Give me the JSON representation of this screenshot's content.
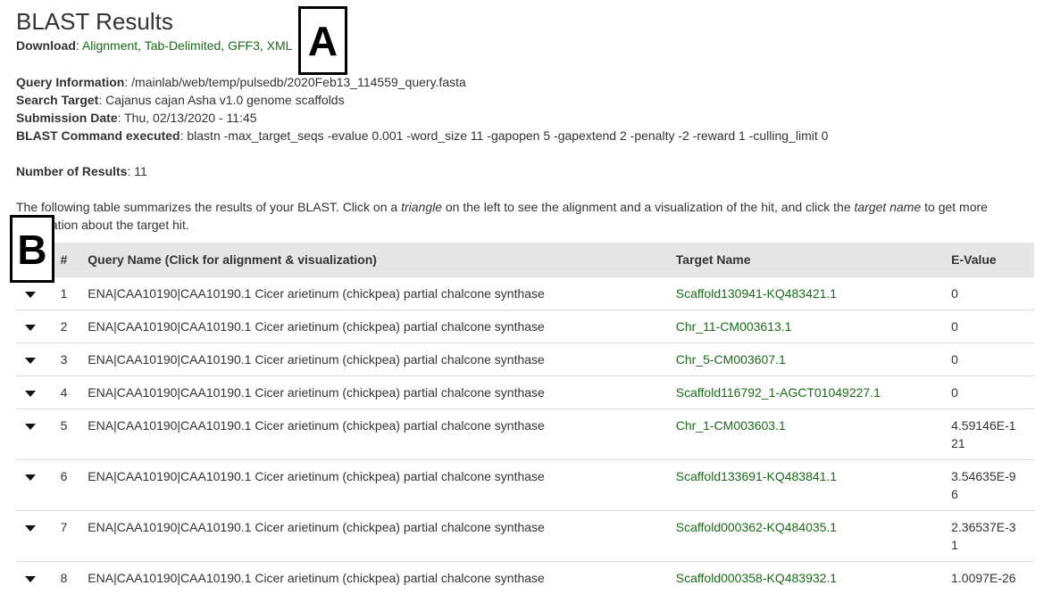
{
  "title": "BLAST Results",
  "download": {
    "label": "Download",
    "links": [
      "Alignment",
      "Tab-Delimited",
      "GFF3",
      "XML"
    ]
  },
  "query_info": {
    "label": "Query Information",
    "value": "/mainlab/web/temp/pulsedb/2020Feb13_114559_query.fasta"
  },
  "search_target": {
    "label": "Search Target",
    "value": "Cajanus cajan Asha v1.0 genome scaffolds"
  },
  "submission_date": {
    "label": "Submission Date",
    "value": "Thu, 02/13/2020 - 11:45"
  },
  "blast_command": {
    "label": "BLAST Command executed",
    "value": "blastn -max_target_seqs -evalue 0.001 -word_size 11 -gapopen 5 -gapextend 2 -penalty -2 -reward 1 -culling_limit 0"
  },
  "num_results": {
    "label": "Number of Results",
    "value": "11"
  },
  "description": {
    "part1": "The following table summarizes the results of your BLAST. Click on a ",
    "em1": "triangle",
    "part2": " on the left to see the alignment and a visualization of the hit, and click the ",
    "em2": "target name",
    "part3": " to get more information about the target hit."
  },
  "table": {
    "headers": {
      "num": "#",
      "query": "Query Name (Click for alignment & visualization)",
      "target": "Target Name",
      "evalue": "E-Value"
    },
    "rows": [
      {
        "num": "1",
        "query": "ENA|CAA10190|CAA10190.1 Cicer arietinum (chickpea) partial chalcone synthase",
        "target": "Scaffold130941-KQ483421.1",
        "evalue": "0"
      },
      {
        "num": "2",
        "query": "ENA|CAA10190|CAA10190.1 Cicer arietinum (chickpea) partial chalcone synthase",
        "target": "Chr_11-CM003613.1",
        "evalue": "0"
      },
      {
        "num": "3",
        "query": "ENA|CAA10190|CAA10190.1 Cicer arietinum (chickpea) partial chalcone synthase",
        "target": "Chr_5-CM003607.1",
        "evalue": "0"
      },
      {
        "num": "4",
        "query": "ENA|CAA10190|CAA10190.1 Cicer arietinum (chickpea) partial chalcone synthase",
        "target": "Scaffold116792_1-AGCT01049227.1",
        "evalue": "0"
      },
      {
        "num": "5",
        "query": "ENA|CAA10190|CAA10190.1 Cicer arietinum (chickpea) partial chalcone synthase",
        "target": "Chr_1-CM003603.1",
        "evalue": "4.59146E-121"
      },
      {
        "num": "6",
        "query": "ENA|CAA10190|CAA10190.1 Cicer arietinum (chickpea) partial chalcone synthase",
        "target": "Scaffold133691-KQ483841.1",
        "evalue": "3.54635E-96"
      },
      {
        "num": "7",
        "query": "ENA|CAA10190|CAA10190.1 Cicer arietinum (chickpea) partial chalcone synthase",
        "target": "Scaffold000362-KQ484035.1",
        "evalue": "2.36537E-31"
      },
      {
        "num": "8",
        "query": "ENA|CAA10190|CAA10190.1 Cicer arietinum (chickpea) partial chalcone synthase",
        "target": "Scaffold000358-KQ483932.1",
        "evalue": "1.0097E-26"
      }
    ]
  },
  "annotations": {
    "a": "A",
    "b": "B"
  },
  "colors": {
    "link": "#1b6b1b",
    "header_bg": "#e6e6e6",
    "text": "#333333"
  }
}
